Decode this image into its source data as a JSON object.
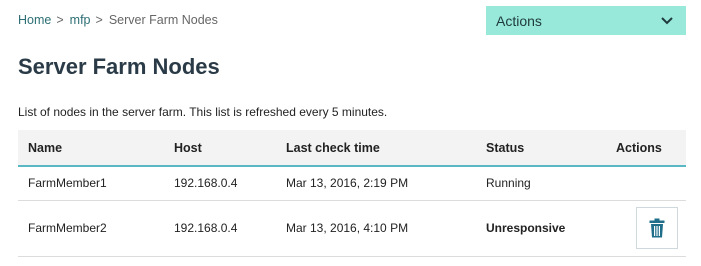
{
  "breadcrumb": {
    "home": "Home",
    "sep1": ">",
    "mfp": "mfp",
    "sep2": ">",
    "current": "Server Farm Nodes"
  },
  "actions_menu": {
    "label": "Actions",
    "icon": "chevron-down-icon",
    "color": "#98e9da"
  },
  "page": {
    "title": "Server Farm Nodes",
    "description": "List of nodes in the server farm. This list is refreshed every 5 minutes."
  },
  "table": {
    "headers": {
      "name": "Name",
      "host": "Host",
      "last_check": "Last check time",
      "status": "Status",
      "actions": "Actions"
    },
    "rows": [
      {
        "name": "FarmMember1",
        "host": "192.168.0.4",
        "last_check": "Mar 13, 2016, 2:19 PM",
        "status": "Running",
        "status_color": "#7cba3d"
      },
      {
        "name": "FarmMember2",
        "host": "192.168.0.4",
        "last_check": "Mar 13, 2016, 4:10 PM",
        "status": "Unresponsive",
        "status_color": "#e0323a",
        "action_icon": "trash-icon"
      }
    ]
  }
}
